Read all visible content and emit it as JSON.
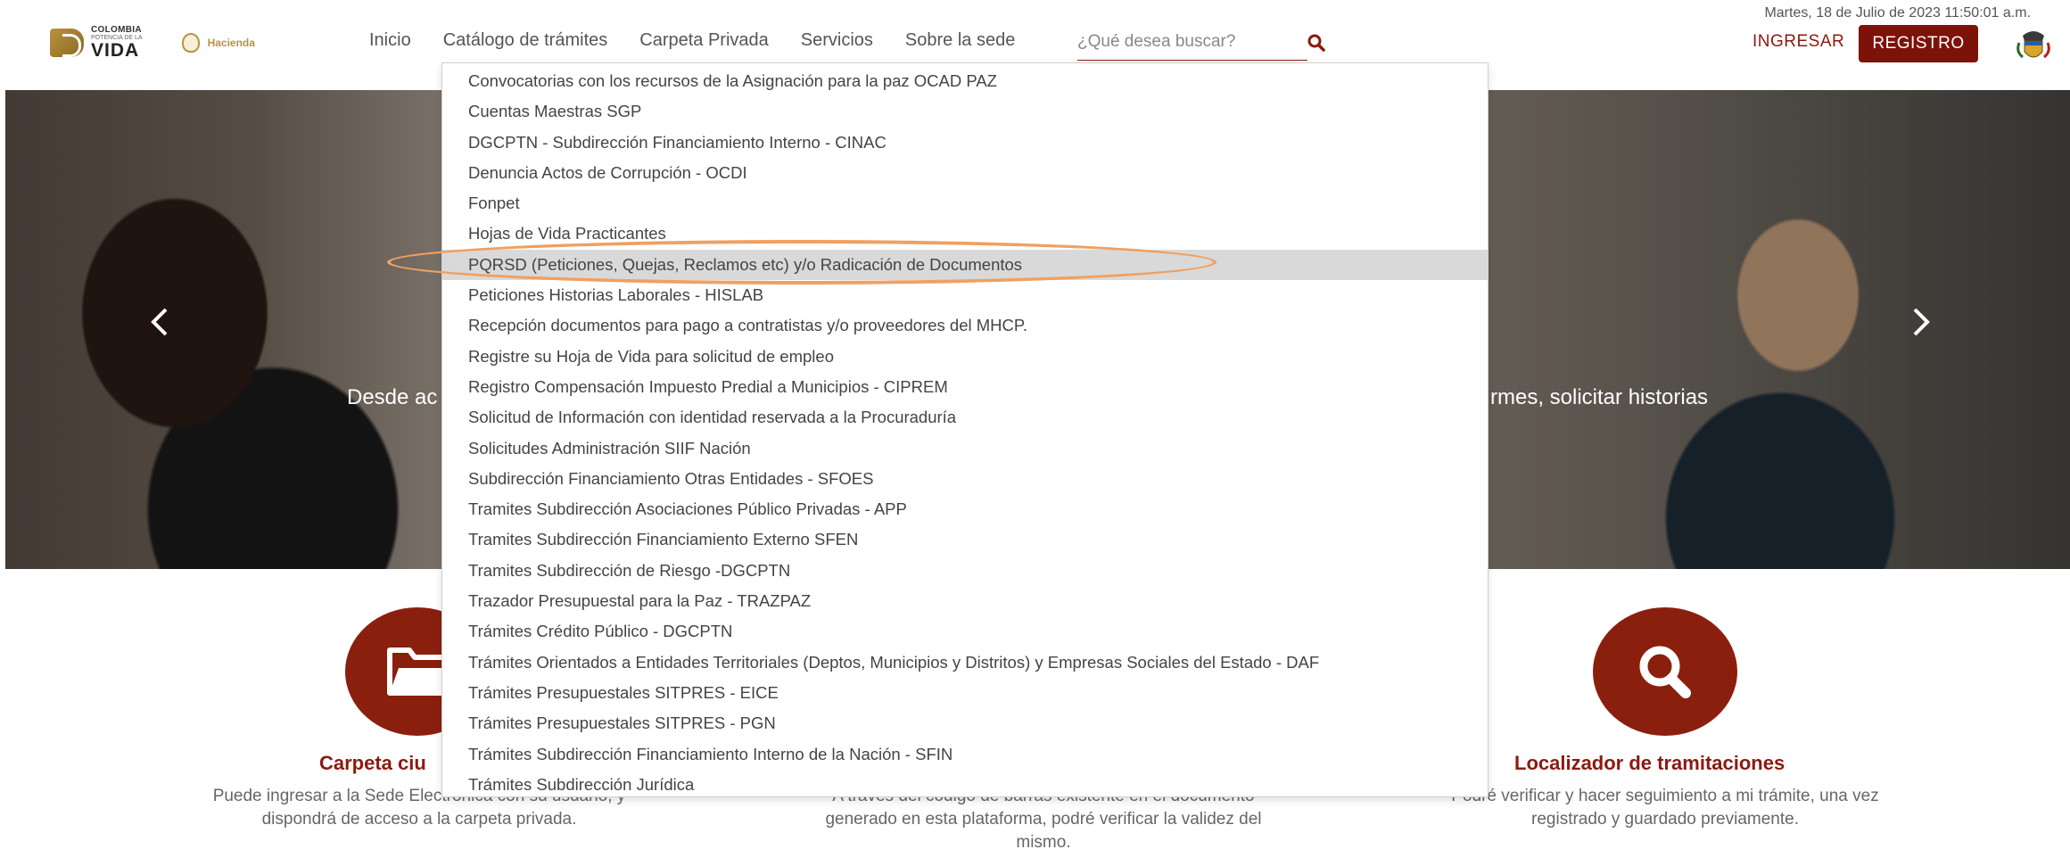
{
  "header": {
    "date": "Martes, 18 de Julio de 2023 11:50:01 a.m.",
    "logo": {
      "line1": "COLOMBIA",
      "line2": "POTENCIA DE LA",
      "line3": "VIDA",
      "hacienda": "Hacienda"
    },
    "nav": [
      "Inicio",
      "Catálogo de trámites",
      "Carpeta Privada",
      "Servicios",
      "Sobre la sede"
    ],
    "search": {
      "placeholder": "¿Qué desea buscar?",
      "value": ""
    },
    "login_label": "INGRESAR",
    "register_label": "REGISTRO"
  },
  "hero": {
    "text_left": "Desde ac",
    "text_right": "rmes, solicitar historias"
  },
  "dropdown": {
    "items": [
      "Convocatorias con los recursos de la Asignación para la paz OCAD PAZ",
      "Cuentas Maestras SGP",
      "DGCPTN - Subdirección Financiamiento Interno - CINAC",
      "Denuncia Actos de Corrupción - OCDI",
      "Fonpet",
      "Hojas de Vida Practicantes",
      "PQRSD (Peticiones, Quejas, Reclamos etc) y/o Radicación de Documentos",
      "Peticiones Historias Laborales - HISLAB",
      "Recepción documentos para pago a contratistas y/o proveedores del MHCP.",
      "Registre su Hoja de Vida para solicitud de empleo",
      "Registro Compensación Impuesto Predial a Municipios - CIPREM",
      "Solicitud de Información con identidad reservada a la Procuraduría",
      "Solicitudes Administración SIIF Nación",
      "Subdirección Financiamiento Otras Entidades - SFOES",
      "Tramites Subdirección Asociaciones Público Privadas - APP",
      "Tramites Subdirección Financiamiento Externo SFEN",
      "Tramites Subdirección de Riesgo -DGCPTN",
      "Trazador Presupuestal para la Paz - TRAZPAZ",
      "Trámites Crédito Público - DGCPTN",
      "Trámites Orientados a Entidades Territoriales (Deptos, Municipios y Distritos) y Empresas Sociales del Estado - DAF",
      "Trámites Presupuestales SITPRES - EICE",
      "Trámites Presupuestales SITPRES - PGN",
      "Trámites Subdirección Financiamiento Interno de la Nación - SFIN",
      "Trámites Subdirección Jurídica"
    ],
    "highlighted_index": 6
  },
  "features": {
    "left": {
      "title": "Carpeta ciu",
      "desc_line1": "Puede ingresar a la Sede Electrónica con su usuario, y",
      "desc_line2": "dispondrá de acceso a la carpeta privada."
    },
    "middle": {
      "desc_line1": "A través del código de barras existente en el documento",
      "desc_line2": "generado en esta plataforma, podré verificar la validez del",
      "desc_line3": "mismo."
    },
    "right": {
      "title": "Localizador de tramitaciones",
      "desc_line1": "Podré verificar y hacer seguimiento a mi trámite, una vez",
      "desc_line2": "registrado y guardado previamente."
    }
  },
  "colors": {
    "brand": "#8b1a10",
    "register_bg": "#7d1208",
    "circle": "#8b1f0e",
    "highlight": "#f0a060",
    "active_row": "#d9d9d9"
  }
}
